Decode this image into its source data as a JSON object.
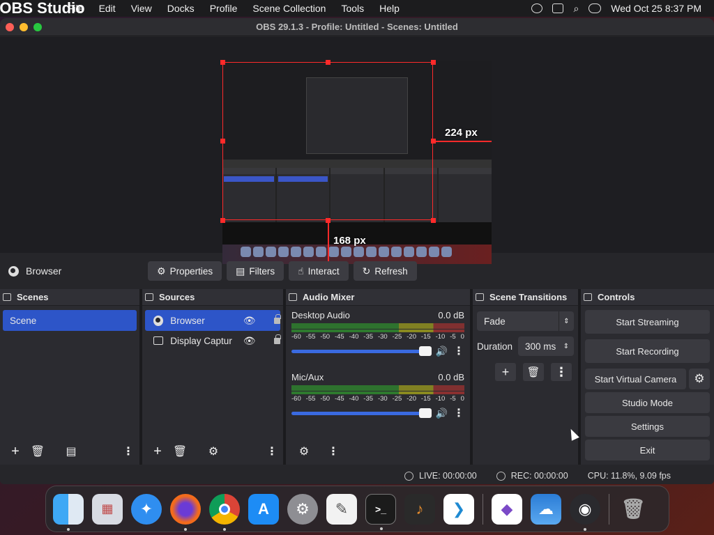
{
  "menubar": {
    "app_name": "OBS Studio",
    "items": [
      "File",
      "Edit",
      "View",
      "Docks",
      "Profile",
      "Scene Collection",
      "Tools",
      "Help"
    ],
    "datetime": "Wed Oct 25  8:37 PM"
  },
  "window": {
    "title": "OBS 29.1.3 - Profile: Untitled - Scenes: Untitled"
  },
  "preview": {
    "width_label": "224 px",
    "height_label": "168 px"
  },
  "source_toolbar": {
    "source_name": "Browser",
    "properties": "Properties",
    "filters": "Filters",
    "interact": "Interact",
    "refresh": "Refresh"
  },
  "scenes": {
    "title": "Scenes",
    "items": [
      "Scene"
    ]
  },
  "sources": {
    "title": "Sources",
    "items": [
      {
        "name": "Browser",
        "icon": "globe-icon"
      },
      {
        "name": "Display Captur",
        "icon": "monitor-icon"
      }
    ]
  },
  "audio_mixer": {
    "title": "Audio Mixer",
    "ticks": [
      "-60",
      "-55",
      "-50",
      "-45",
      "-40",
      "-35",
      "-30",
      "-25",
      "-20",
      "-15",
      "-10",
      "-5",
      "0"
    ],
    "channels": [
      {
        "name": "Desktop Audio",
        "level": "0.0 dB",
        "volume": 1.0
      },
      {
        "name": "Mic/Aux",
        "level": "0.0 dB",
        "volume": 1.0
      }
    ]
  },
  "scene_transitions": {
    "title": "Scene Transitions",
    "transition": "Fade",
    "duration_label": "Duration",
    "duration_value": "300 ms"
  },
  "controls": {
    "title": "Controls",
    "start_streaming": "Start Streaming",
    "start_recording": "Start Recording",
    "start_virtual_camera": "Start Virtual Camera",
    "studio_mode": "Studio Mode",
    "settings": "Settings",
    "exit": "Exit"
  },
  "status": {
    "live": "LIVE: 00:00:00",
    "rec": "REC: 00:00:00",
    "cpu": "CPU: 11.8%, 9.09 fps"
  },
  "dock_apps": [
    "finder",
    "launchpad",
    "safari",
    "firefox",
    "chrome",
    "app-store",
    "system-settings",
    "textedit",
    "terminal",
    "garageband",
    "vscode",
    "visual-studio",
    "weather",
    "obs",
    "trash"
  ]
}
